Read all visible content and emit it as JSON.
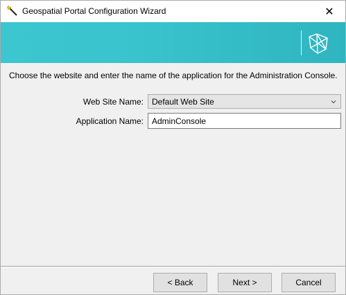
{
  "window": {
    "title": "Geospatial Portal Configuration Wizard",
    "close_glyph": "✕"
  },
  "icons": {
    "title_icon": "wizard-wand-icon",
    "logo": "hexagon-geometry-logo",
    "select_chevron": "chevron-down-icon"
  },
  "colors": {
    "banner": "#3cc6cf",
    "button_bg": "#e1e1e1"
  },
  "instructions": "Choose the website and enter the name of the application for the Administration Console.",
  "form": {
    "web_site_label": "Web Site Name:",
    "web_site_value": "Default Web Site",
    "application_label": "Application Name:",
    "application_value": "AdminConsole"
  },
  "buttons": {
    "back": "< Back",
    "next": "Next >",
    "cancel": "Cancel"
  }
}
